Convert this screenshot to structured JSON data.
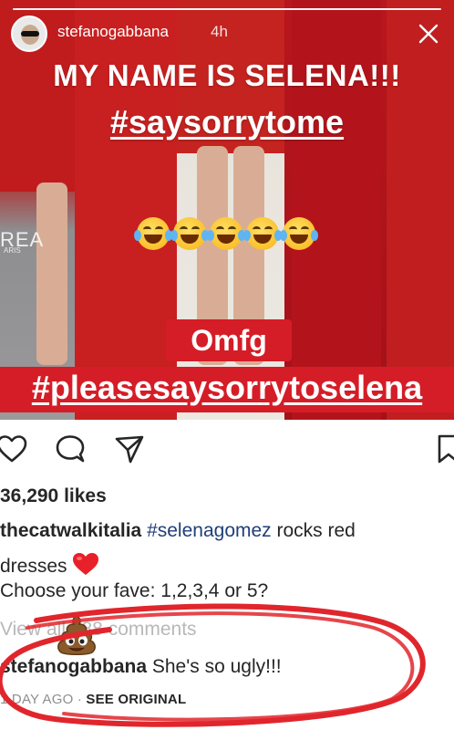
{
  "story": {
    "username": "stefanogabbana",
    "time_ago": "4h",
    "line1": "MY NAME IS SELENA!!!",
    "line2": "#saysorrytome",
    "line3": "Omfg",
    "line4": "#pleasesaysorrytoselena",
    "background_brand": "REA",
    "background_brand_sub": "ARIS"
  },
  "post": {
    "likes": "36,290 likes",
    "caption": {
      "user": "thecatwalkitalia",
      "hashtag": "#selenagomez",
      "text1": " rocks red",
      "text2": "dresses",
      "text3": "Choose your fave: 1,2,3,4 or 5?"
    },
    "view_all": "View all 788 comments",
    "comment": {
      "user": "stefanogabbana",
      "text": " She's so ugly!!!"
    },
    "meta": {
      "age": "1 DAY AGO",
      "separator": " · ",
      "see_original": "SEE ORIGINAL"
    }
  },
  "colors": {
    "story_red": "#d51d27",
    "scribble_red": "#e0262c",
    "hashtag_blue": "#1f3f78"
  },
  "icons": [
    "close-icon",
    "heart-icon",
    "comment-icon",
    "share-icon",
    "bookmark-icon",
    "laughing-emoji",
    "heart-emoji",
    "poop-emoji"
  ]
}
